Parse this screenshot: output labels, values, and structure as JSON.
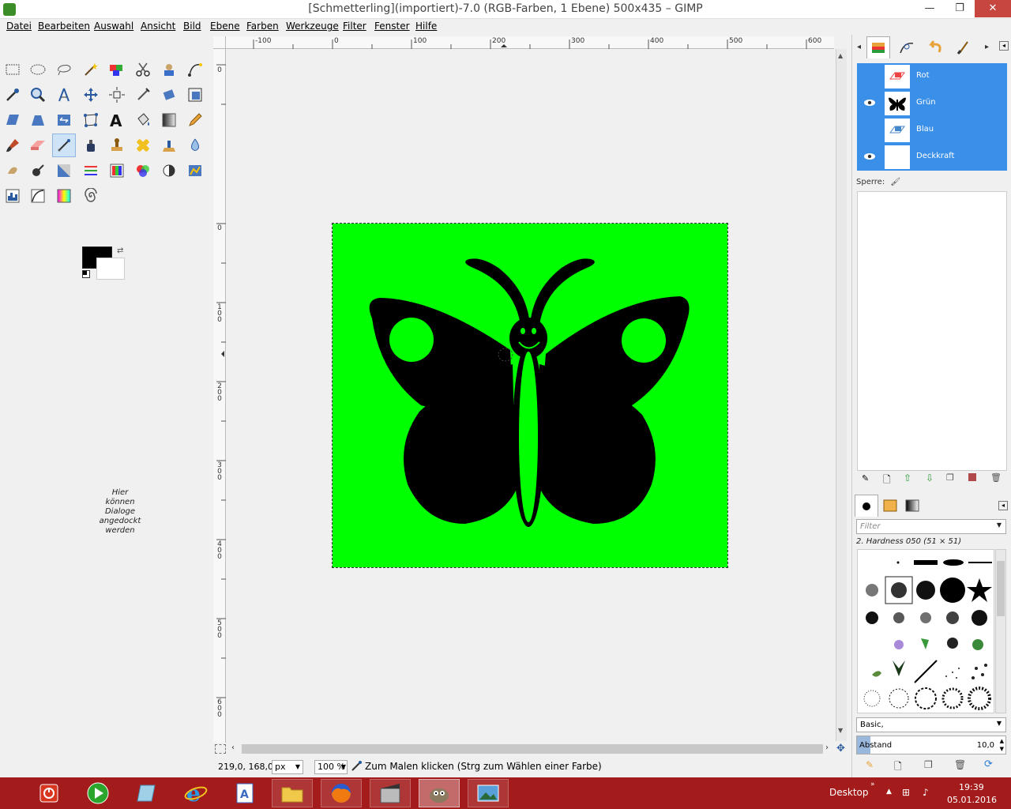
{
  "window": {
    "title": "[Schmetterling](importiert)-7.0 (RGB-Farben, 1 Ebene) 500x435 – GIMP",
    "minimize": "—",
    "maximize": "❐",
    "close": "✕"
  },
  "menubar": [
    "Datei",
    "Bearbeiten",
    "Auswahl",
    "Ansicht",
    "Bild",
    "Ebene",
    "Farben",
    "Werkzeuge",
    "Filter",
    "Fenster",
    "Hilfe"
  ],
  "toolbox": {
    "dock_hint": [
      "Hier",
      "können",
      "Dialoge",
      "angedockt",
      "werden"
    ],
    "foreground_color": "#000000",
    "background_color": "#ffffff"
  },
  "rulers": {
    "h_labels": [
      "-100",
      "0",
      "100",
      "200",
      "300",
      "400",
      "500",
      "600"
    ],
    "v_labels": [
      "0",
      "0",
      "100",
      "200",
      "300",
      "400",
      "500",
      "600"
    ]
  },
  "canvas": {
    "image_bg": "#00ff00",
    "butterfly_color": "#000000"
  },
  "statusbar": {
    "coords": "219,0, 168,0",
    "unit": "px",
    "zoom": "100 %",
    "message": "Zum Malen klicken (Strg zum Wählen einer Farbe)"
  },
  "layers_panel": {
    "channels": [
      {
        "name": "Rot",
        "visible": false
      },
      {
        "name": "Grün",
        "visible": true
      },
      {
        "name": "Blau",
        "visible": false
      },
      {
        "name": "Deckkraft",
        "visible": true
      }
    ],
    "lock_label": "Sperre:"
  },
  "brushes_panel": {
    "filter_placeholder": "Filter",
    "selected_brush": "2. Hardness 050 (51 × 51)",
    "brush_set": "Basic,",
    "spacing_label": "Abstand",
    "spacing_value": "10,0"
  },
  "taskbar": {
    "desktop_label": "Desktop",
    "time": "19:39",
    "date": "05.01.2016"
  }
}
